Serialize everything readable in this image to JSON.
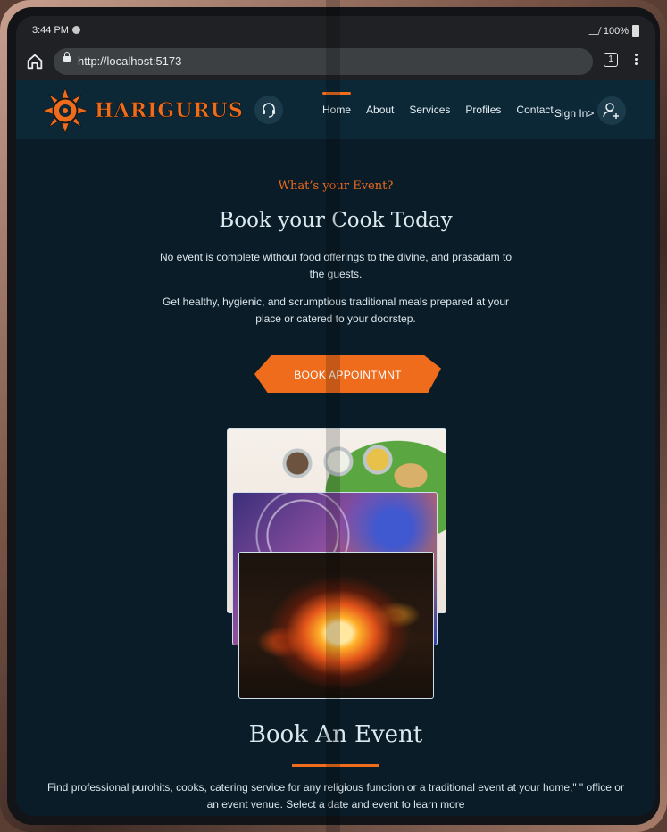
{
  "status_bar": {
    "time": "3:44 PM",
    "battery": "100%"
  },
  "browser": {
    "url": "http://localhost:5173",
    "tab_count": "1"
  },
  "site": {
    "brand": "HARIGURUS",
    "nav": [
      "Home",
      "About",
      "Services",
      "Profiles",
      "Contact"
    ],
    "active_nav": "Home",
    "sign_in": "Sign In>"
  },
  "hero": {
    "tagline": "What’s your Event?",
    "title": "Book your Cook Today",
    "paragraph1": "No event is complete without food offerings to the divine, and prasadam to the guests.",
    "paragraph2": "Get healthy, hygienic, and scrumptious traditional meals prepared at your place or catered to your doorstep.",
    "cta": "BOOK APPOINTMNT"
  },
  "event": {
    "title": "Book An Event",
    "description": "Find professional purohits, cooks, catering service for any religious function or a traditional event at your home,\" \" office or an event venue. Select a date and event to learn more"
  },
  "colors": {
    "accent": "#ef6c1c",
    "background": "#0a1c28",
    "nav_bg": "#0c2836"
  },
  "icons": [
    "home-icon",
    "lock-icon",
    "tab-switcher-icon",
    "more-menu-icon",
    "sun-logo-icon",
    "headset-icon",
    "add-user-icon"
  ]
}
